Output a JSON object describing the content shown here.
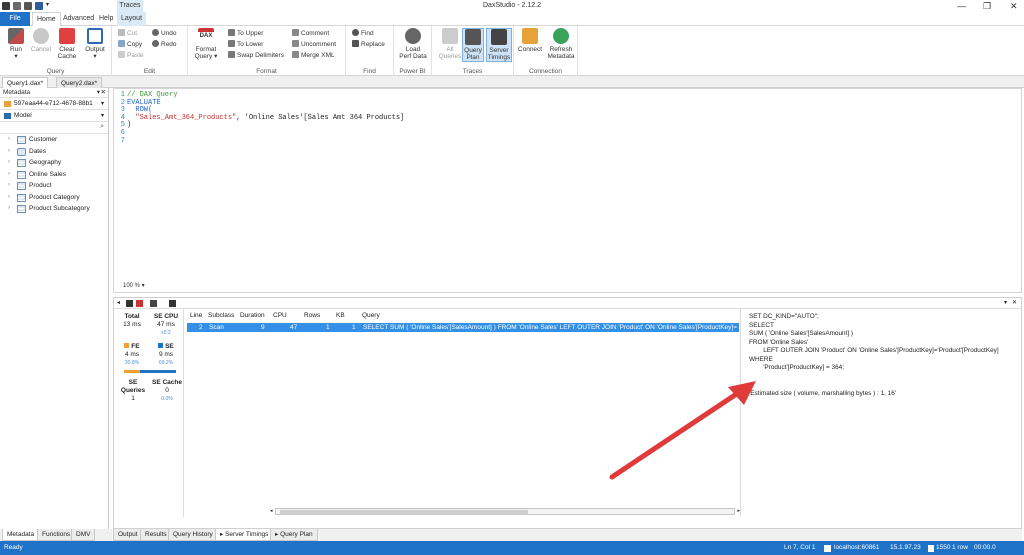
{
  "app": {
    "title": "DaxStudio - 2.12.2"
  },
  "ribbon_tabs": {
    "file": "File",
    "home": "Home",
    "advanced": "Advanced",
    "help": "Help",
    "traces_context": "Traces",
    "layout": "Layout"
  },
  "ribbon": {
    "query": {
      "label": "Query",
      "run": "Run",
      "cancel": "Cancel",
      "clear_cache": "Clear Cache",
      "output": "Output"
    },
    "edit": {
      "label": "Edit",
      "cut": "Cut",
      "copy": "Copy",
      "paste": "Paste",
      "undo": "Undo",
      "redo": "Redo"
    },
    "format": {
      "label": "Format",
      "format_query": "Format Query",
      "to_upper": "To Upper",
      "to_lower": "To Lower",
      "swap_delimiters": "Swap Delimiters",
      "comment": "Comment",
      "uncomment": "Uncomment",
      "merge_xml": "Merge XML"
    },
    "find": {
      "label": "Find",
      "find": "Find",
      "replace": "Replace"
    },
    "powerbi": {
      "label": "Power BI",
      "load_perf": "Load Perf Data"
    },
    "traces": {
      "label": "Traces",
      "all_queries": "All Queries",
      "query_plan": "Query Plan",
      "server_timings": "Server Timings"
    },
    "connection": {
      "label": "Connection",
      "connect": "Connect",
      "refresh_metadata": "Refresh Metadata"
    }
  },
  "doc_tabs": [
    "Query1.dax*",
    "Query2.dax*"
  ],
  "metadata": {
    "header": "Metadata",
    "database": "597eaa44-e712-4678-88b1",
    "model": "Model",
    "tables": [
      "Customer",
      "Dates",
      "Geography",
      "Online Sales",
      "Product",
      "Product Category",
      "Product Subcategory"
    ]
  },
  "editor": {
    "zoom": "100 %",
    "line_numbers": [
      "1",
      "2",
      "3",
      "4",
      "5",
      "6",
      "7"
    ],
    "lines": {
      "l1": "// DAX Query",
      "l2": "EVALUATE",
      "l3": "  ROW(",
      "l4a": "  \"Sales_Amt_364_Products\"",
      "l4b": ", 'Online Sales'[Sales Amt 364 Products]",
      "l5": ")"
    }
  },
  "server_timings": {
    "total_label": "Total",
    "total_value": "13 ms",
    "se_cpu_label": "SE CPU",
    "se_cpu_value": "47 ms",
    "se_cpu_ratio": "x5.2",
    "fe_label": "FE",
    "fe_value": "4 ms",
    "fe_pct": "30.8%",
    "se_label": "SE",
    "se_value": "9 ms",
    "se_pct": "69.2%",
    "se_queries_label": "SE Queries",
    "se_queries_value": "1",
    "se_cache_label": "SE Cache",
    "se_cache_value": "0",
    "se_cache_pct": "0.0%",
    "columns": [
      "Line",
      "Subclass",
      "Duration",
      "CPU",
      "Rows",
      "KB",
      "Query"
    ],
    "row": {
      "line": "2",
      "subclass": "Scan",
      "duration": "9",
      "cpu": "47",
      "rows": "1",
      "kb": "1",
      "query": "SELECT SUM ( 'Online Sales'[SalesAmount] ) FROM 'Online Sales' LEFT OUTER JOIN 'Product' ON 'Online Sales'[ProductKey]='Product'["
    },
    "sql": "SET DC_KIND=\"AUTO\";\nSELECT\nSUM ( 'Online Sales'[SalesAmount] )\nFROM 'Online Sales'\n        LEFT OUTER JOIN 'Product' ON 'Online Sales'[ProductKey]='Product'[ProductKey]\nWHERE\n        'Product'[ProductKey] = 364;\n\n\n'Estimated size ( volume, marshalling bytes ) : 1, 16'"
  },
  "bottom_tabs": [
    "Output",
    "Results",
    "Query History",
    "Server Timings",
    "Query Plan"
  ],
  "left_tabs": [
    "Metadata",
    "Functions",
    "DMV"
  ],
  "status": {
    "left": "Ready",
    "position": "Ln 7, Col 1",
    "server": "localhost:60861",
    "version": "15.1.97.23",
    "spid": "1550",
    "rows": "1 row",
    "duration": "00:00.0"
  },
  "colors": {
    "accent": "#1e73c8",
    "selected_row": "#3390e6",
    "arrow": "#e03a3a",
    "fe": "#f0a030",
    "se": "#1e73c8"
  }
}
